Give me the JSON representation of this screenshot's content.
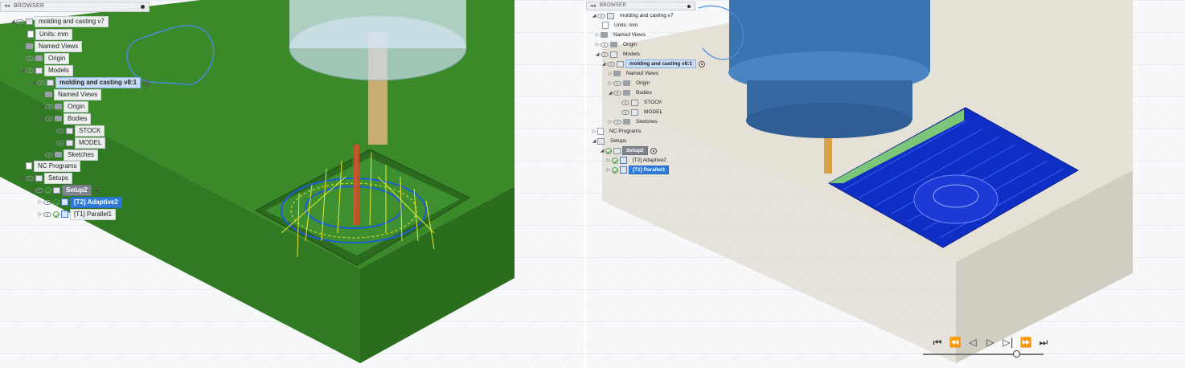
{
  "browser_header": "BROWSER",
  "left_tree": [
    {
      "label": "molding and casting v7"
    },
    {
      "label": "Units: mm"
    },
    {
      "label": "Named Views"
    },
    {
      "label": "Origin"
    },
    {
      "label": "Models"
    },
    {
      "label": "molding and casting v8:1"
    },
    {
      "label": "Named Views"
    },
    {
      "label": "Origin"
    },
    {
      "label": "Bodies"
    },
    {
      "label": "STOCK"
    },
    {
      "label": "MODEL"
    },
    {
      "label": "Sketches"
    },
    {
      "label": "NC Programs"
    },
    {
      "label": "Setups"
    },
    {
      "label": "Setup2"
    },
    {
      "label": "[T2] Adaptive2"
    },
    {
      "label": "[T1] Parallel1"
    }
  ],
  "right_tree": [
    {
      "label": "molding and casting v7"
    },
    {
      "label": "Units: mm"
    },
    {
      "label": "Named Views"
    },
    {
      "label": "Origin"
    },
    {
      "label": "Models"
    },
    {
      "label": "molding and casting v8:1"
    },
    {
      "label": "Named Views"
    },
    {
      "label": "Origin"
    },
    {
      "label": "Bodies"
    },
    {
      "label": "STOCK"
    },
    {
      "label": "MODEL"
    },
    {
      "label": "Sketches"
    },
    {
      "label": "NC Programs"
    },
    {
      "label": "Setups"
    },
    {
      "label": "Setup2"
    },
    {
      "label": "[T2] Adaptive2"
    },
    {
      "label": "[T1] Parallel1"
    }
  ],
  "playback": {
    "buttons": [
      "⏮",
      "⏪",
      "◁",
      "▷",
      "▷|",
      "⏩",
      "⏭"
    ],
    "position": 0.77
  },
  "colors": {
    "stock_left": "#2f7a22",
    "stock_right": "#e2ddd3",
    "toolpath": "#e8e835",
    "toolpath_right": "#1433c8",
    "tool_holder": "#3b73b0",
    "selection_blue": "#2f7bd9"
  }
}
